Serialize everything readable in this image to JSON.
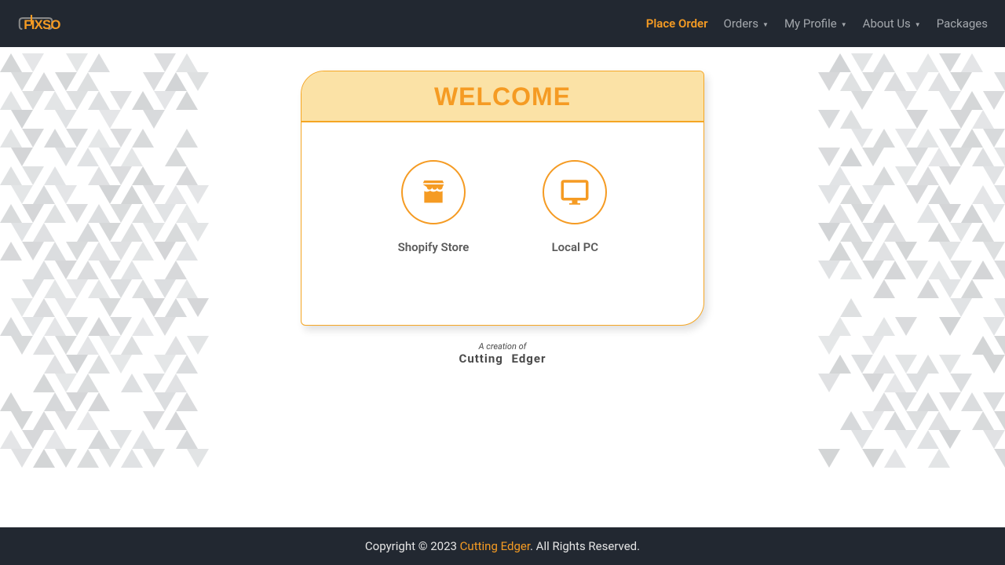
{
  "brand": "FIXSO",
  "nav": {
    "placeOrder": "Place Order",
    "orders": "Orders",
    "myProfile": "My Profile",
    "aboutUs": "About Us",
    "packages": "Packages"
  },
  "card": {
    "title": "WELCOME",
    "shopify": "Shopify Store",
    "localPc": "Local PC"
  },
  "creation": {
    "top": "A creation of",
    "bottom": "Cutting Edger"
  },
  "footer": {
    "prefix": "Copyright © 2023 ",
    "brand": "Cutting Edger",
    "suffix": ". All Rights Reserved."
  },
  "colors": {
    "accent": "#f59b23"
  }
}
